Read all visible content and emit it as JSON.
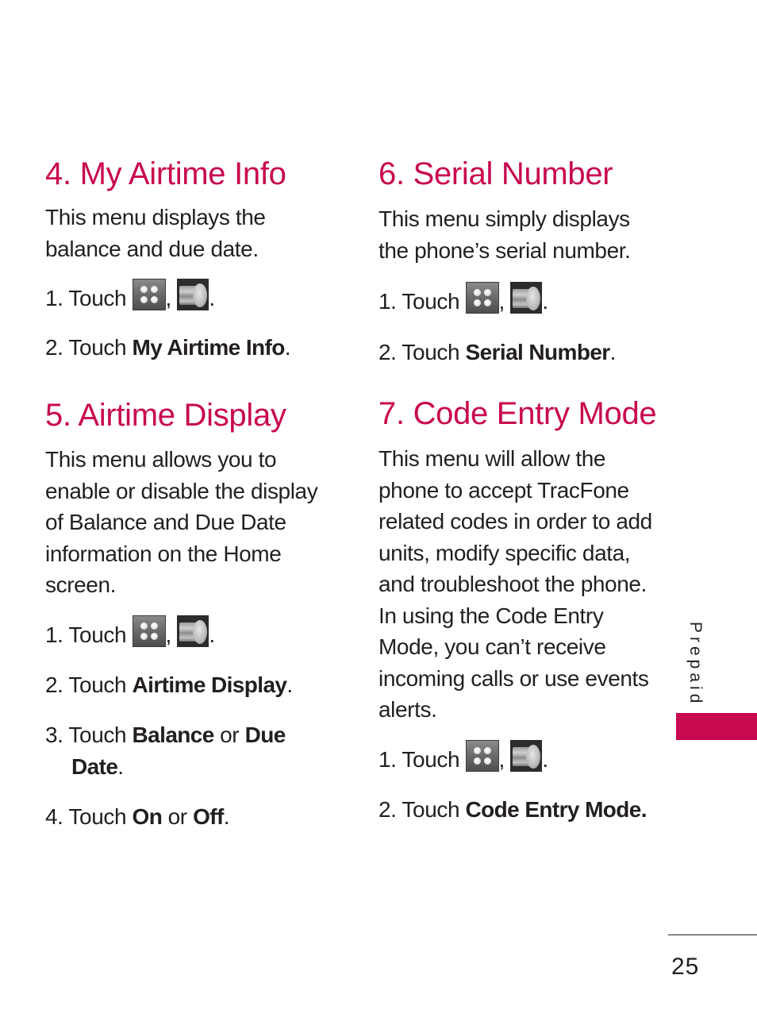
{
  "colors": {
    "heading": "#c8084f",
    "text": "#231f20",
    "tab_accent": "#c8084f"
  },
  "icons": {
    "menu": "menu-grid-icon",
    "prepaid": "prepaid-icon"
  },
  "sections": {
    "s4": {
      "heading": "4. My Airtime Info",
      "desc": [
        "This menu displays the",
        "balance and due date."
      ],
      "steps": {
        "a": {
          "num": "1. Touch",
          "sep": ",",
          "end": "."
        },
        "b": {
          "num": "2. Touch",
          "bold": "My Airtime Info",
          "end": "."
        }
      }
    },
    "s5": {
      "heading": "5. Airtime Display",
      "desc": [
        "This menu allows you to",
        "enable or disable the display",
        "of Balance and Due Date",
        "information on the Home",
        "screen."
      ],
      "steps": {
        "a": {
          "num": "1. Touch",
          "sep": ",",
          "end": "."
        },
        "b": {
          "num": "2. Touch",
          "bold": "Airtime Display",
          "end": "."
        },
        "c": {
          "num": "3. Touch",
          "bold1": "Balance",
          "or": " or ",
          "bold2": "Due",
          "bold3": "Date",
          "end": "."
        },
        "d": {
          "num": "4. Touch",
          "bold1": "On",
          "or": " or ",
          "bold2": "Off",
          "end": "."
        }
      }
    },
    "s6": {
      "heading": "6. Serial Number",
      "desc": [
        "This menu simply displays",
        "the phone’s serial number."
      ],
      "steps": {
        "a": {
          "num": "1. Touch",
          "sep": ",",
          "end": "."
        },
        "b": {
          "num": "2. Touch",
          "bold": "Serial Number",
          "end": "."
        }
      }
    },
    "s7": {
      "heading": "7. Code Entry Mode",
      "desc": [
        "This menu will allow the",
        "phone to accept TracFone",
        "related codes in order to add",
        "units, modify specific data,",
        "and troubleshoot the phone.",
        "In using the Code Entry",
        "Mode, you can’t receive",
        "incoming calls or use events",
        "alerts."
      ],
      "steps": {
        "a": {
          "num": "1. Touch",
          "sep": ",",
          "end": "."
        },
        "b": {
          "num": "2. Touch",
          "bold": "Code Entry Mode."
        }
      }
    }
  },
  "sidebar": {
    "label": "Prepaid"
  },
  "footer": {
    "page_number": "25"
  }
}
